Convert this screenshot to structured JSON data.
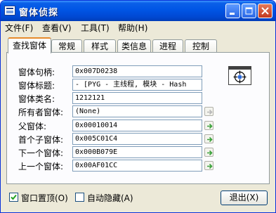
{
  "window": {
    "title": "窗体侦探"
  },
  "menu": [
    "文件(F)",
    "查看(V)",
    "工具(T)",
    "帮助(H)"
  ],
  "tabs": [
    "查找窗体",
    "常规",
    "样式",
    "类信息",
    "进程",
    "控制"
  ],
  "active_tab": "查找窗体",
  "fields": [
    {
      "label": "窗体句柄:",
      "value": "0x007D0238"
    },
    {
      "label": "窗体标题:",
      "value": " - [PYG - 主线程, 模块 - Hash"
    },
    {
      "label": "窗体类名:",
      "value": "1212121"
    },
    {
      "label": "所有者窗体:",
      "value": "(None)"
    },
    {
      "label": "父窗体:",
      "value": "0x00010014"
    },
    {
      "label": "首个子窗体:",
      "value": "0x005C01C4"
    },
    {
      "label": "下一个窗体:",
      "value": "0x000B079E"
    },
    {
      "label": "上一个窗体:",
      "value": "0x00AF01CC"
    }
  ],
  "options": {
    "topmost_label": "窗口置顶(O)",
    "topmost_checked": true,
    "autohide_label": "自动隐藏(A)",
    "autohide_checked": false
  },
  "exit_label": "退出(X)",
  "colors": {
    "titlebar": "#0055e5",
    "active_tab_accent": "#e68b2c",
    "arrow_enabled": "#3aa13a",
    "arrow_disabled": "#b8b8b8"
  }
}
